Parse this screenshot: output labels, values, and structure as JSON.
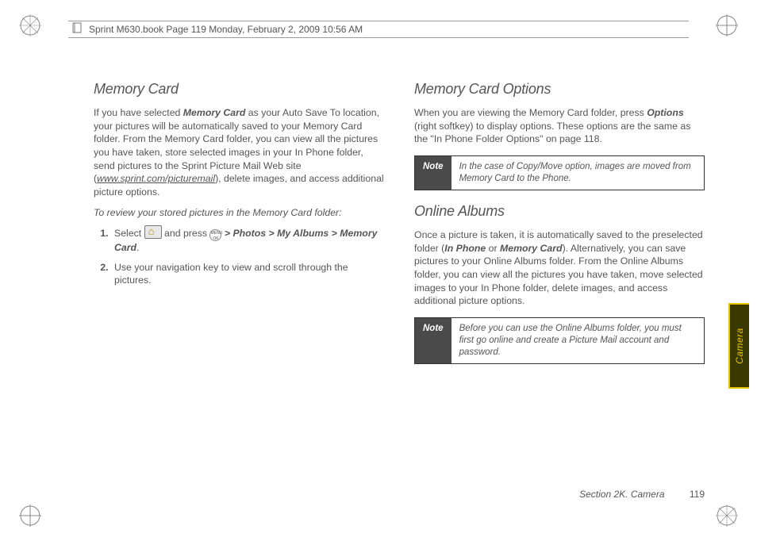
{
  "header": {
    "text": "Sprint M630.book  Page 119  Monday, February 2, 2009  10:56 AM"
  },
  "left": {
    "h": "Memory Card",
    "p1a": "If you have selected ",
    "p1b": "Memory Card",
    "p1c": " as your Auto Save To location, your pictures will be automatically saved to your Memory Card folder. From the Memory Card folder, you can view all the pictures you have taken, store selected images in your In Phone folder, send pictures to the Sprint Picture Mail Web site (",
    "p1d": "www.sprint.com/picturemail",
    "p1e": "), delete images, and access additional picture options.",
    "sub": "To review your stored pictures in the Memory Card folder:",
    "s1a": "Select ",
    "s1b": " and press ",
    "s1c": "  > Photos > My Albums > Memory Card",
    "s1d": ".",
    "s2": "Use your navigation key to view and scroll through the pictures."
  },
  "right": {
    "h1": "Memory Card Options",
    "p1a": "When you are viewing the Memory Card folder, press ",
    "p1b": "Options",
    "p1c": " (right softkey) to display options. These options are the same as the \"In Phone Folder Options\" on page 118.",
    "note1_label": "Note",
    "note1_body": "In the case of Copy/Move option, images are moved from Memory Card to the Phone.",
    "h2": "Online Albums",
    "p2a": "Once a picture is taken, it is automatically saved to the preselected folder (",
    "p2b": "In Phone",
    "p2c": " or ",
    "p2d": "Memory Card",
    "p2e": "). Alternatively, you can save pictures to your Online Albums folder. From the Online Albums folder, you can view all the pictures you have taken, move selected images to your In Phone folder, delete images, and access additional picture options.",
    "note2_label": "Note",
    "note2_body": "Before you can use the Online Albums folder, you must first go online and create a Picture Mail account and password."
  },
  "sideTab": "Camera",
  "footer": {
    "section": "Section 2K. Camera",
    "page": "119"
  },
  "menuok": "MENU OK"
}
